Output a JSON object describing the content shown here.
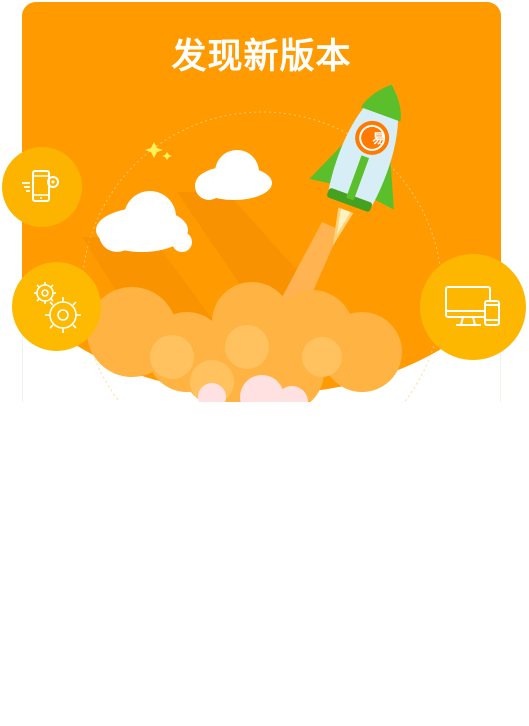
{
  "dialog": {
    "title": "发现新版本",
    "rocket_badge_text": "易"
  },
  "badges": [
    {
      "name": "phone-settings-icon"
    },
    {
      "name": "gears-icon"
    },
    {
      "name": "monitor-phone-icon"
    }
  ],
  "colors": {
    "header_orange": "#ff9b00",
    "badge_yellow": "#fdb400",
    "rocket_green": "#5bbf2b",
    "rocket_body": "#d8eef6",
    "cloud_white": "#ffffff",
    "smoke_orange": "#ffb342"
  }
}
